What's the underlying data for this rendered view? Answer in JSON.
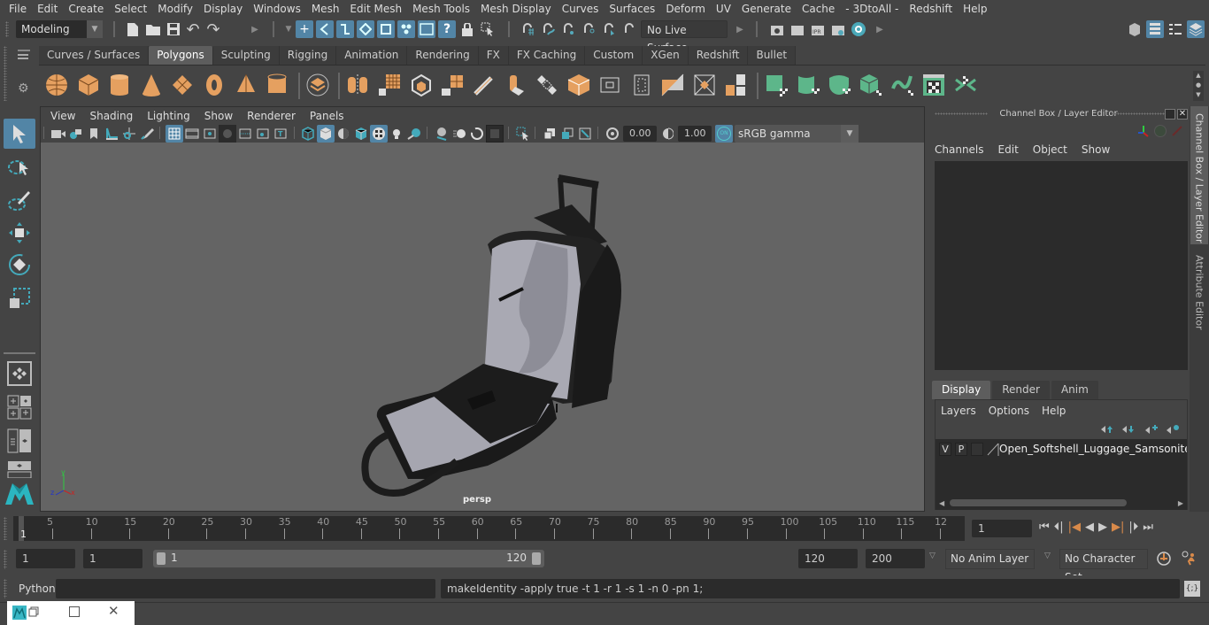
{
  "menubar": {
    "items": [
      "File",
      "Edit",
      "Create",
      "Select",
      "Modify",
      "Display",
      "Windows",
      "Mesh",
      "Edit Mesh",
      "Mesh Tools",
      "Mesh Display",
      "Curves",
      "Surfaces",
      "Deform",
      "UV",
      "Generate",
      "Cache",
      "- 3DtoAll -",
      "Redshift",
      "Help"
    ]
  },
  "toolbar": {
    "mode_selector": "Modeling",
    "live_surface": "No Live Surface"
  },
  "shelf": {
    "tabs": [
      "Curves / Surfaces",
      "Polygons",
      "Sculpting",
      "Rigging",
      "Animation",
      "Rendering",
      "FX",
      "FX Caching",
      "Custom",
      "XGen",
      "Redshift",
      "Bullet"
    ],
    "active_tab": "Polygons",
    "accent_orange": "#e5a060",
    "accent_green": "#5db68a"
  },
  "viewport": {
    "menu": [
      "View",
      "Shading",
      "Lighting",
      "Show",
      "Renderer",
      "Panels"
    ],
    "exposure": "0.00",
    "gamma": "1.00",
    "color_toggle": "ON",
    "color_space": "sRGB gamma",
    "camera_label": "persp",
    "axis": {
      "x": "x",
      "y": "y",
      "z": "z"
    }
  },
  "channel_box": {
    "title": "Channel Box / Layer Editor",
    "menu": [
      "Channels",
      "Edit",
      "Object",
      "Show"
    ]
  },
  "layer_editor": {
    "tabs": [
      "Display",
      "Render",
      "Anim"
    ],
    "active_tab": "Display",
    "menu": [
      "Layers",
      "Options",
      "Help"
    ],
    "layers": [
      {
        "v": "V",
        "p": "P",
        "name": "Open_Softshell_Luggage_Samsonite_Bla"
      }
    ]
  },
  "side_tabs": [
    "Channel Box / Layer Editor",
    "Attribute Editor"
  ],
  "timeline": {
    "ticks": [
      "5",
      "10",
      "15",
      "20",
      "25",
      "30",
      "35",
      "40",
      "45",
      "50",
      "55",
      "60",
      "65",
      "70",
      "75",
      "80",
      "85",
      "90",
      "95",
      "100",
      "105",
      "110",
      "115",
      "12"
    ],
    "current_frame_marker": "1",
    "current_frame": "1"
  },
  "range": {
    "start": "1",
    "playback_start": "1",
    "slider_start": "1",
    "slider_end": "120",
    "playback_end": "120",
    "end": "200",
    "anim_layer": "No Anim Layer",
    "character_set": "No Character Set"
  },
  "command_line": {
    "language": "Python",
    "input": "",
    "result": "makeIdentity -apply true -t 1 -r 1 -s 1 -n 0 -pn 1;"
  }
}
